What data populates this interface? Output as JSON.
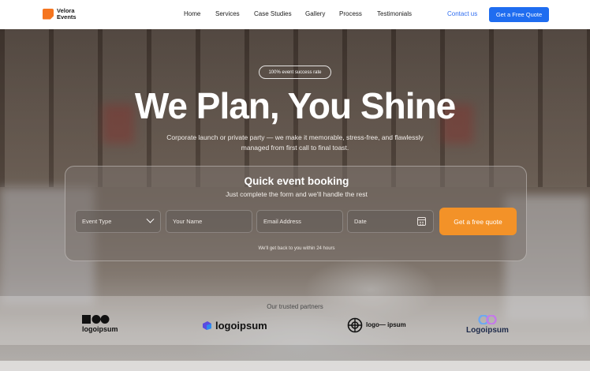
{
  "brand": {
    "line1": "Velora",
    "line2": "Events",
    "color": "#f5751f"
  },
  "nav": {
    "links": [
      "Home",
      "Services",
      "Case Studies",
      "Gallery",
      "Process",
      "Testimonials"
    ],
    "contact": "Contact us",
    "cta": "Get a Free Quote",
    "accent": "#1f6df0"
  },
  "hero": {
    "badge": "100% event success rate",
    "headline": "We Plan, You Shine",
    "subtitle": "Corporate launch or private party — we make it memorable, stress-free, and flawlessly managed from first call to final toast."
  },
  "booking": {
    "title": "Quick event booking",
    "subtitle": "Just complete the form and we'll handle the rest",
    "fields": {
      "event_type": "Event Type",
      "name": "Your Name",
      "email": "Email Address",
      "date": "Date"
    },
    "cta": "Get a free quote",
    "cta_color": "#f39228",
    "note": "We'll get back to you within 24 hours"
  },
  "partners": {
    "title": "Our trusted partners",
    "logos": [
      "logoipsum",
      "logoipsum",
      "logo— ipsum",
      "Logoipsum"
    ]
  }
}
